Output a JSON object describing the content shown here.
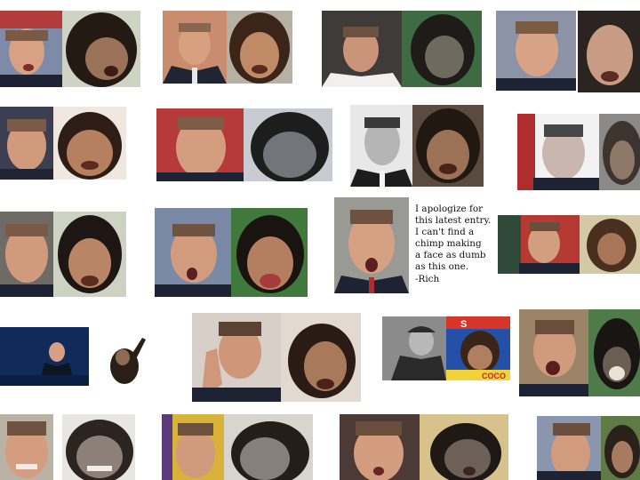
{
  "note": {
    "lines": [
      "I apologize for",
      "this latest entry.",
      "I can't find a",
      "chimp making",
      "a face as dumb",
      "as this one.",
      "-Rich"
    ]
  },
  "cereal_box": {
    "brand_top": "S",
    "brand_bottom": "COCO"
  },
  "colors": {
    "background": "#ffffff",
    "skin": "#d49a7c",
    "chimp_fur": "#2a1f18",
    "chimp_face": "#b98a6a",
    "suit": "#1d2333"
  }
}
